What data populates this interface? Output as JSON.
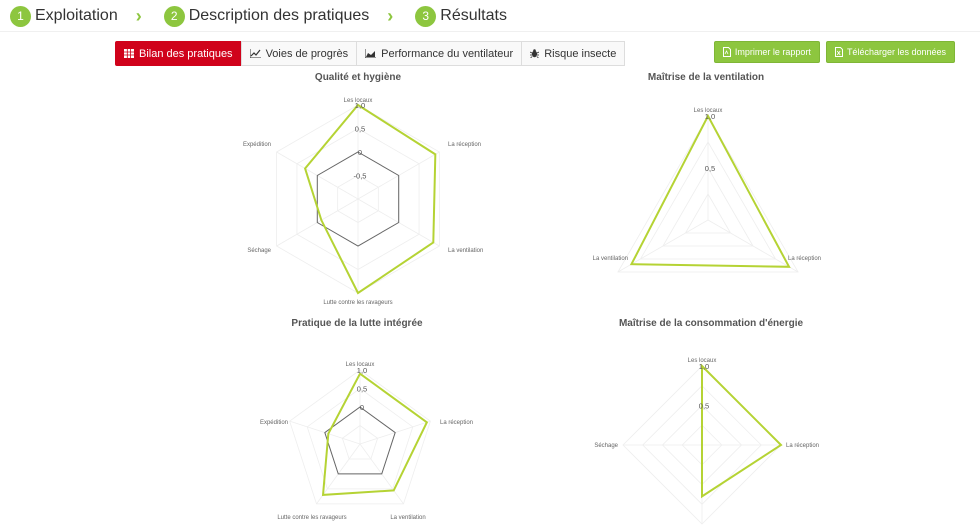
{
  "stepper": [
    {
      "num": "1",
      "label": "Exploitation"
    },
    {
      "num": "2",
      "label": "Description des pratiques"
    },
    {
      "num": "3",
      "label": "Résultats"
    }
  ],
  "tabs": [
    {
      "label": "Bilan des pratiques",
      "icon": "table-icon",
      "active": true
    },
    {
      "label": "Voies de progrès",
      "icon": "line-chart-icon",
      "active": false
    },
    {
      "label": "Performance du ventilateur",
      "icon": "area-chart-icon",
      "active": false
    },
    {
      "label": "Risque insecte",
      "icon": "bug-icon",
      "active": false
    }
  ],
  "actions": {
    "print_label": "Imprimer le rapport",
    "download_label": "Télécharger les données"
  },
  "colors": {
    "accent": "#8dc63f",
    "active_tab": "#d0021b",
    "series": "#b5d334",
    "reference": "#666666"
  },
  "chart_data": [
    {
      "type": "radar",
      "title": "Qualité et hygiène",
      "axes": [
        "Les locaux",
        "La réception",
        "La ventilation",
        "Lutte contre les ravageurs",
        "Séchage",
        "Expédition"
      ],
      "ticks": [
        "1,0",
        "0,5",
        "0",
        "-0,5"
      ],
      "range": [
        -1,
        1
      ],
      "series": [
        {
          "values": [
            1,
            0.9,
            0.85,
            1,
            -0.1,
            0.3
          ]
        }
      ],
      "reference": [
        0,
        0,
        0,
        0,
        0,
        0
      ]
    },
    {
      "type": "radar",
      "title": "Maîtrise de la ventilation",
      "axes": [
        "Les locaux",
        "La réception",
        "La ventilation"
      ],
      "ticks": [
        "1,0",
        "0,5"
      ],
      "range": [
        0,
        1
      ],
      "series": [
        {
          "values": [
            1,
            0.9,
            0.85
          ]
        }
      ]
    },
    {
      "type": "radar",
      "title": "Pratique de la lutte intégrée",
      "axes": [
        "Les locaux",
        "La réception",
        "La ventilation",
        "Lutte contre les ravageurs",
        "Expédition"
      ],
      "ticks": [
        "1,0",
        "0,5",
        "0"
      ],
      "range": [
        -1,
        1
      ],
      "series": [
        {
          "values": [
            0.9,
            0.9,
            0.55,
            0.7,
            -0.1
          ]
        }
      ],
      "reference": [
        0,
        0,
        0,
        0,
        0
      ]
    },
    {
      "type": "radar",
      "title": "Maîtrise de la consommation d'énergie",
      "axes": [
        "Les locaux",
        "La réception",
        "",
        "Séchage"
      ],
      "ticks": [
        "1,0",
        "0,5"
      ],
      "range": [
        0,
        1
      ],
      "series": [
        {
          "values": [
            1,
            1,
            0.65,
            0
          ]
        }
      ]
    }
  ]
}
